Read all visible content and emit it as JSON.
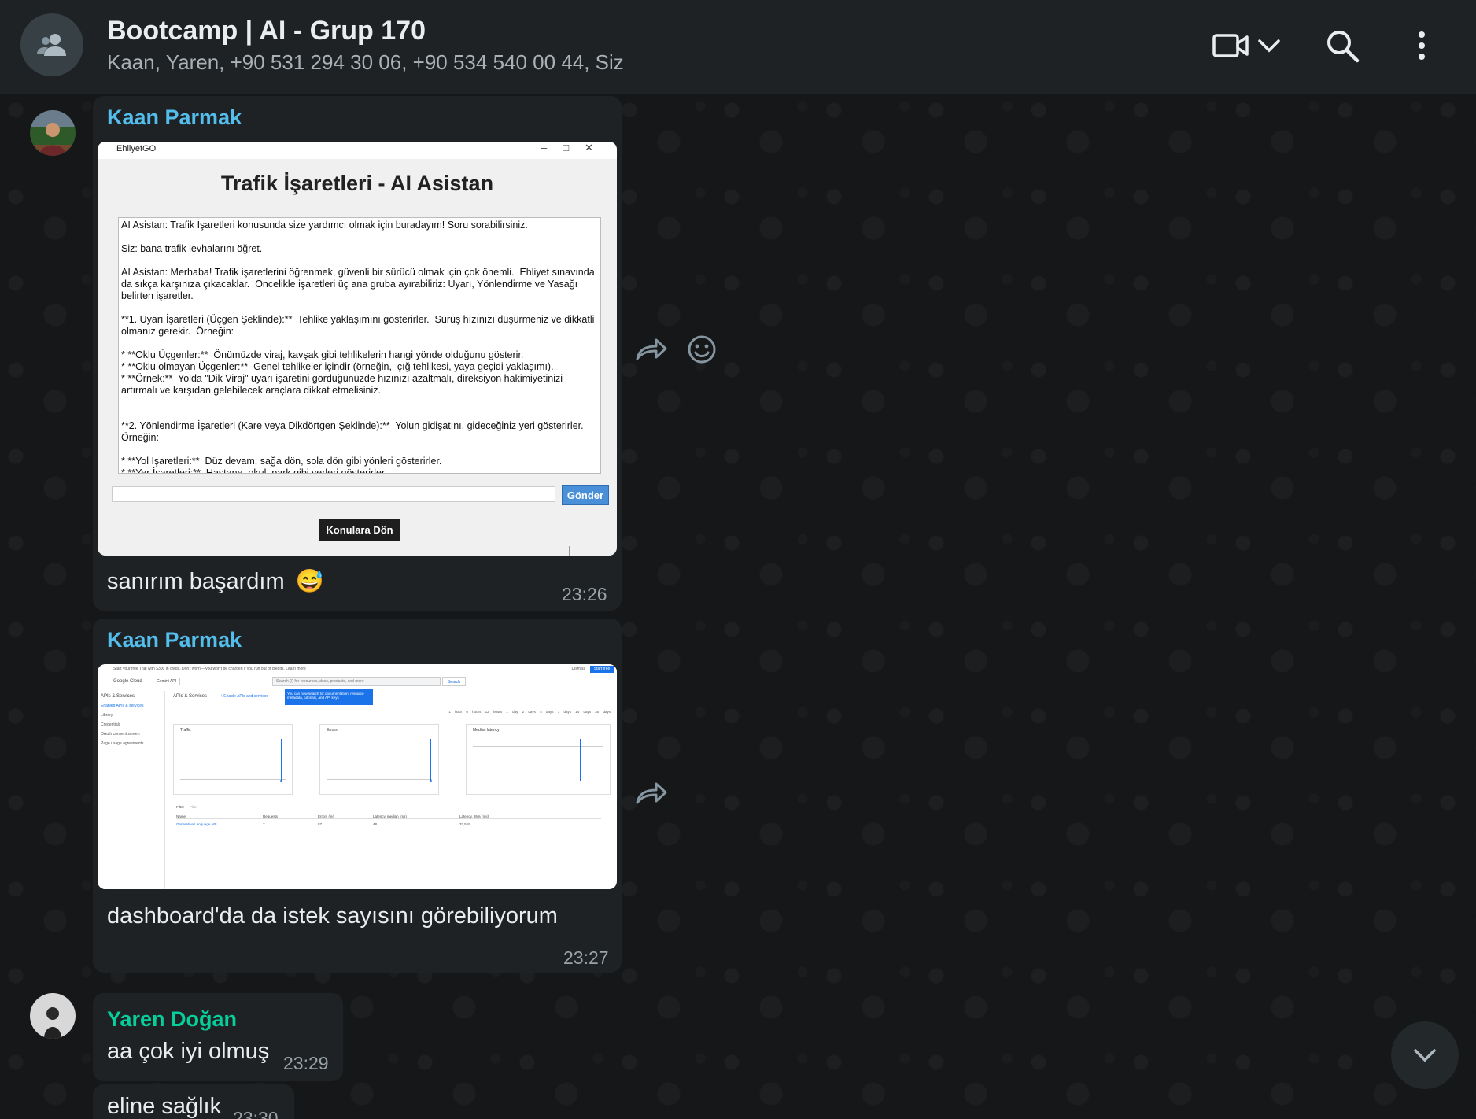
{
  "header": {
    "title": "Bootcamp | AI - Grup 170",
    "participants": "Kaan, Yaren, +90 531 294 30 06, +90 534 540 00 44, Siz"
  },
  "colors": {
    "sender_kaan": "#53bdeb",
    "sender_yaren": "#06cf9c",
    "bubble": "#1f2224",
    "background": "#151718"
  },
  "messages": [
    {
      "sender": "Kaan Parmak",
      "text": "sanırım başardım",
      "emoji": "😅",
      "time": "23:26",
      "attachment": {
        "window_title": "EhliyetGO",
        "heading": "Trafik İşaretleri - AI Asistan",
        "conversation": [
          "AI Asistan: Trafik İşaretleri konusunda size yardımcı olmak için buradayım! Soru sorabilirsiniz.",
          "",
          "Siz: bana trafik levhalarını öğret.",
          "",
          "AI Asistan: Merhaba! Trafik işaretlerini öğrenmek, güvenli bir sürücü olmak için çok önemli.  Ehliyet sınavında da sıkça karşınıza çıkacaklar.  Öncelikle işaretleri üç ana gruba ayırabiliriz: Uyarı, Yönlendirme ve Yasağı belirten işaretler.",
          "",
          "**1. Uyarı İşaretleri (Üçgen Şeklinde):**  Tehlike yaklaşımını gösterirler.  Sürüş hızınızı düşürmeniz ve dikkatli olmanız gerekir.  Örneğin:",
          "",
          "* **Oklu Üçgenler:**  Önümüzde viraj, kavşak gibi tehlikelerin hangi yönde olduğunu gösterir.",
          "* **Oklu olmayan Üçgenler:**  Genel tehlikeler içindir (örneğin,  çığ tehlikesi, yaya geçidi yaklaşımı).",
          "* **Örnek:**  Yolda \"Dik Viraj\" uyarı işaretini gördüğünüzde hızınızı azaltmalı, direksiyon hakimiyetinizi artırmalı ve karşıdan gelebilecek araçlara dikkat etmelisiniz.",
          "",
          "",
          "**2. Yönlendirme İşaretleri (Kare veya Dikdörtgen Şeklinde):**  Yolun gidişatını, gideceğiniz yeri gösterirler.  Örneğin:",
          "",
          "* **Yol İşaretleri:**  Düz devam, sağa dön, sola dön gibi yönleri gösterirler.",
          "* **Yer İşaretleri:**  Hastane, okul, park gibi yerleri gösterirler."
        ],
        "send_label": "Gönder",
        "back_label": "Konulara Dön"
      }
    },
    {
      "sender": "Kaan Parmak",
      "text": "dashboard'da da istek sayısını görebiliyorum",
      "time": "23:27",
      "attachment": {
        "banner": "Start your free Trial with $300 in credit. Don't worry—you won't be charged if you run out of credits. Learn more",
        "banner_dismiss": "Dismiss",
        "banner_button": "Start free",
        "product": "Google Cloud",
        "project": "Gemini API",
        "search_placeholder": "Search (/) for resources, docs, products, and more",
        "search_button": "Search",
        "tooltip": "You can now search for documentation, resource metadata, tutorials, and API keys",
        "side_header": "APIs & Services",
        "side_items": [
          "Enabled APIs & services",
          "Library",
          "Credentials",
          "OAuth consent screen",
          "Page usage agreements"
        ],
        "main_title": "APIs & Services",
        "enable_link": "+ Enable APIs and services",
        "time_ranges": [
          "1 hour",
          "6 hours",
          "12 hours",
          "1 day",
          "2 days",
          "4 days",
          "7 days",
          "14 days",
          "30 days"
        ],
        "cards": [
          "Traffic",
          "Errors",
          "Median latency"
        ],
        "filter_label": "Filter",
        "filter_placeholder": "Filter",
        "table_headers": [
          "Name",
          "Requests",
          "Errors (%)",
          "Latency, median (ms)",
          "Latency, 95% (ms)"
        ],
        "table_row": [
          "Generative Language API",
          "7",
          "57",
          "48",
          "32,519"
        ]
      }
    },
    {
      "sender": "Yaren Doğan",
      "text": "aa çok iyi olmuş",
      "time": "23:29"
    },
    {
      "text": "eline sağlık",
      "time": "23:30"
    }
  ]
}
